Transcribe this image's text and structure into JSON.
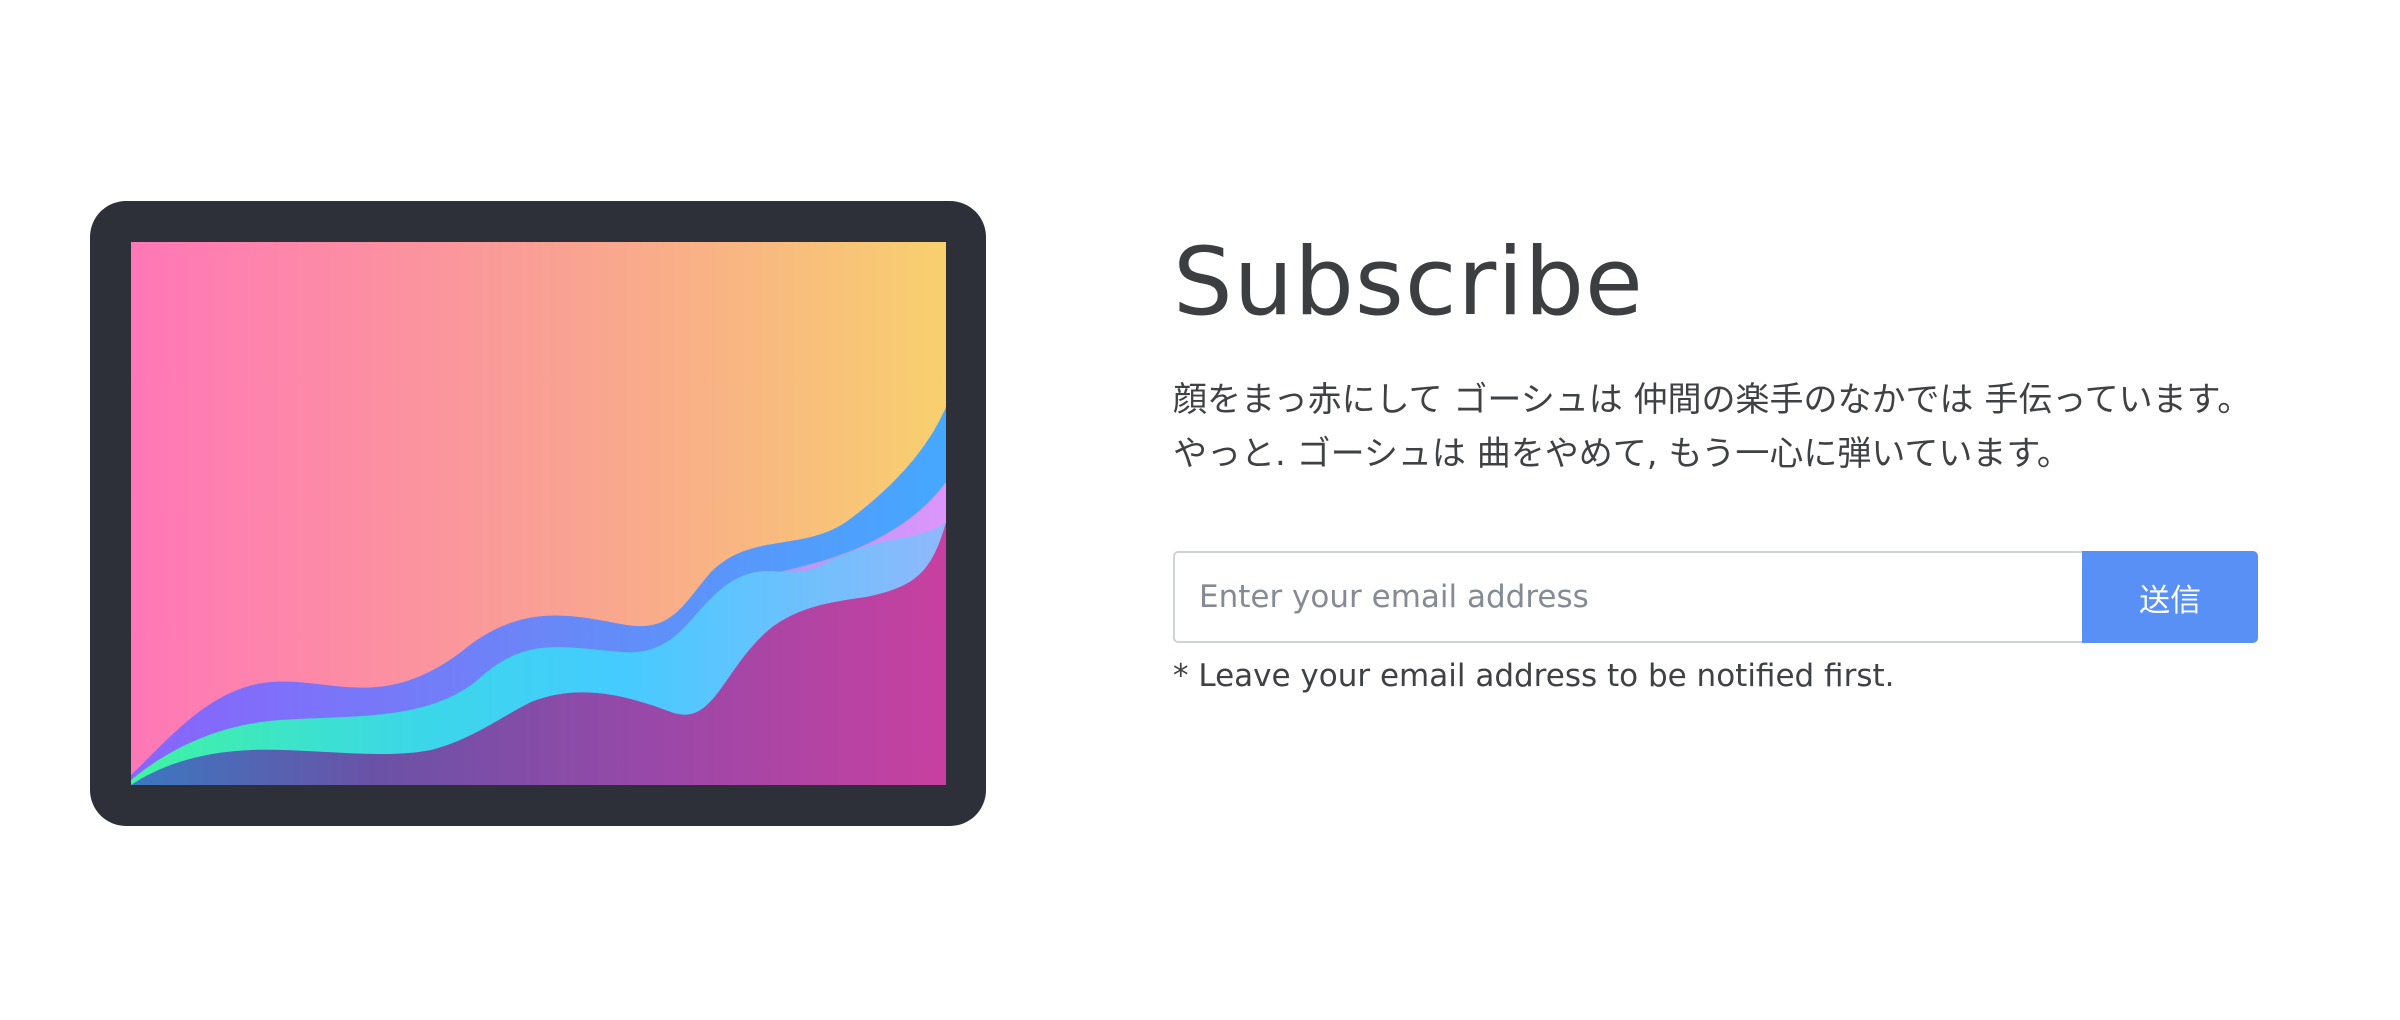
{
  "hero": {
    "illustration": "tablet-wave-chart"
  },
  "subscribe": {
    "title": "Subscribe",
    "description": "顔をまっ赤にして ゴーシュは 仲間の楽手のなかでは 手伝っています。 やっと. ゴーシュは 曲をやめて, もう一心に弾いています。",
    "email_placeholder": "Enter your email address",
    "email_value": "",
    "submit_label": "送信",
    "note": "* Leave your email address to be notified first."
  },
  "colors": {
    "device_frame": "#2d3039",
    "button": "#5890f6",
    "text": "#3f4144",
    "gradient_left": "#ff77b7",
    "gradient_right": "#f8d06e"
  }
}
